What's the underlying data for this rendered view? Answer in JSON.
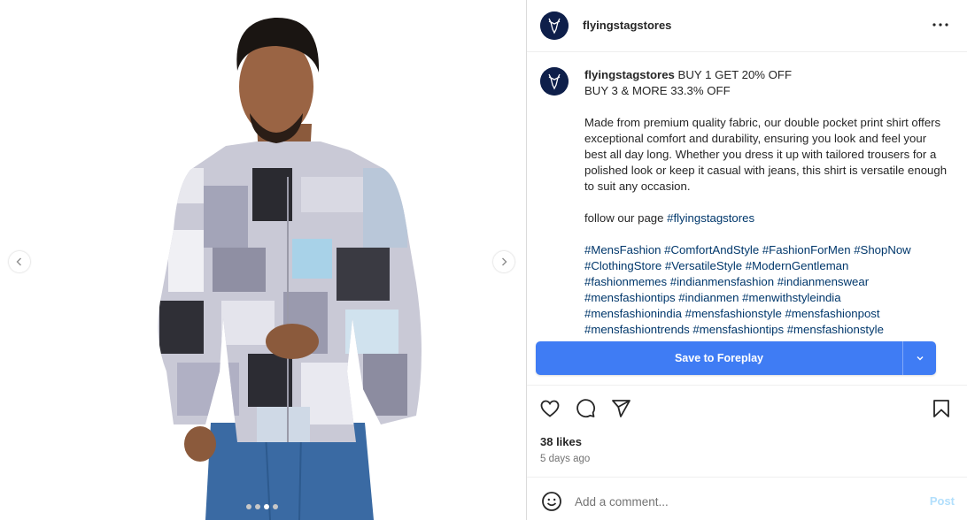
{
  "post": {
    "username": "flyingstagstores",
    "caption_lines": [
      "BUY 1 GET 20% OFF",
      "BUY 3 & MORE 33.3% OFF"
    ],
    "body": "Made from premium quality fabric, our double pocket print shirt offers exceptional comfort and durability, ensuring you look and feel your best all day long. Whether you dress it up with tailored trousers for a polished look or keep it casual with jeans, this shirt is versatile enough to suit any occasion.",
    "follow_text": "follow our page ",
    "follow_tag": "#flyingstagstores",
    "hashtag_lines": [
      "#MensFashion #ComfortAndStyle #FashionForMen #ShopNow",
      "#ClothingStore #VersatileStyle #ModernGentleman",
      "#fashionmemes #indianmensfashion #indianmenswear",
      "#mensfashiontips #indianmen #menwithstyleindia",
      "#mensfashionindia #mensfashionstyle #mensfashionpost",
      "#mensfashiontrends #mensfashiontips #mensfashionstyle"
    ],
    "likes": "38 likes",
    "time": "5 days ago"
  },
  "save_button": {
    "label": "Save to Foreplay"
  },
  "comment": {
    "placeholder": "Add a comment...",
    "post_label": "Post"
  },
  "carousel": {
    "slide_count": 4,
    "active_index": 2
  },
  "colors": {
    "save_blue": "#3f7cf4",
    "link": "#00376b",
    "avatar_bg": "#0e1f4a"
  },
  "icons": [
    "chevron-left-icon",
    "chevron-right-icon",
    "more-icon",
    "heart-icon",
    "comment-icon",
    "share-icon",
    "bookmark-icon",
    "emoji-icon",
    "chevron-down-icon"
  ]
}
